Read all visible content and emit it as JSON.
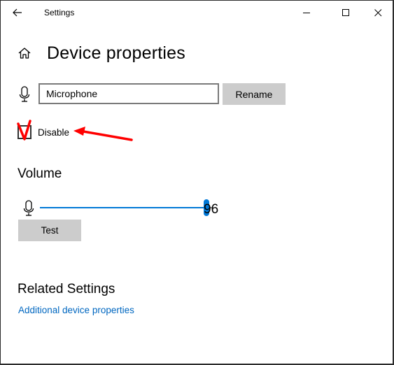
{
  "window": {
    "title": "Settings",
    "controls": {
      "back": "back-arrow-icon",
      "minimize": "minimize-icon",
      "maximize": "maximize-icon",
      "close": "close-icon"
    }
  },
  "header": {
    "home_icon": "home-icon",
    "title": "Device properties"
  },
  "device": {
    "icon": "microphone-icon",
    "name_value": "Microphone",
    "rename_label": "Rename",
    "disable_label": "Disable",
    "disable_checked": false
  },
  "volume": {
    "title": "Volume",
    "icon": "microphone-icon",
    "value": 96,
    "value_text": "96",
    "min": 0,
    "max": 100,
    "test_label": "Test"
  },
  "related": {
    "title": "Related Settings",
    "link_label": "Additional device properties"
  },
  "annotations": {
    "checkmark": "red-v-mark",
    "arrow": "red-arrow-pointing-left",
    "color": "#ff0000"
  },
  "colors": {
    "accent": "#0078d7",
    "link": "#0067c0",
    "button_bg": "#cccccc"
  }
}
